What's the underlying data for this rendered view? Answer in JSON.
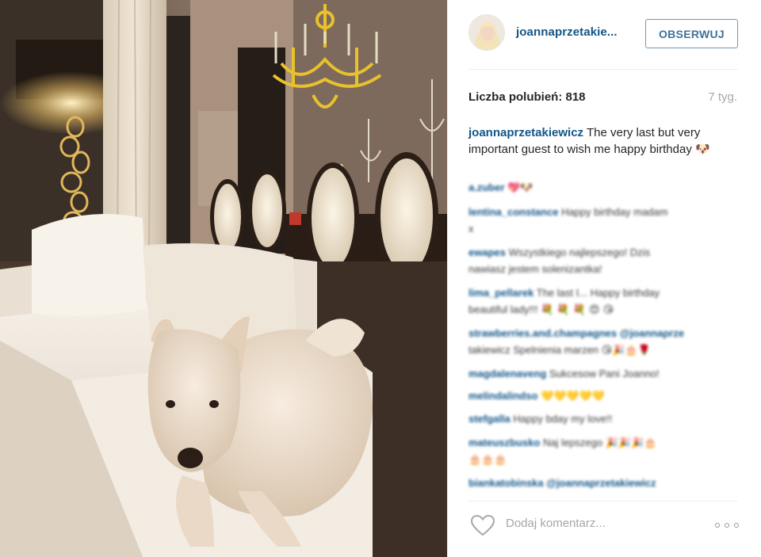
{
  "post": {
    "photo_alt": "",
    "header": {
      "username": "joannaprzetakie...",
      "follow_label": "OBSERWUJ"
    },
    "likes_text": "Liczba polubień: 818",
    "time_ago": "7 tyg.",
    "caption": {
      "username": "joannaprzetakiewicz",
      "text": "The very last but very important guest to wish me happy birthday",
      "emoji": "🐶"
    },
    "comments": [
      {
        "user": "a.zuber",
        "text": "",
        "emoji": "💖🐶"
      },
      {
        "user": "lentina_constance",
        "text": "Happy birthday madam",
        "text2": "x"
      },
      {
        "user": "ewapes",
        "text": "Wszystkiego najlepszego! Dzis",
        "text2": "nawiasz jestem solenizantka!"
      },
      {
        "user": "lima_pellarek",
        "text": "The last I... Happy birthday",
        "text2": "beautiful lady!!!",
        "emoji": "💐 💐 💐 😍 😘"
      },
      {
        "user": "strawberries.and.champagnes",
        "text": "@joannaprze",
        "text2": "takiewicz Spelnienia marzen",
        "emoji": "😘🎉🎂🌹"
      },
      {
        "user": "magdalenaveng",
        "text": "Sukcesow Pani Joanno!"
      },
      {
        "user": "melindalindso",
        "text": "",
        "emoji": "💛💛💛💛💛"
      },
      {
        "user": "stefgalla",
        "text": "Happy bday my love!!"
      },
      {
        "user": "mateuszbusko",
        "text": "Naj lepszego",
        "emoji": "🎉🎉🎉🎂",
        "text2": "🎂🎂🎂"
      },
      {
        "user": "biankatobinska",
        "text": "@joannaprzetakiewicz"
      }
    ],
    "add_comment_placeholder": "Dodaj komentarz...",
    "icons": {
      "like": "heart-icon",
      "more": "more-options-icon"
    }
  }
}
